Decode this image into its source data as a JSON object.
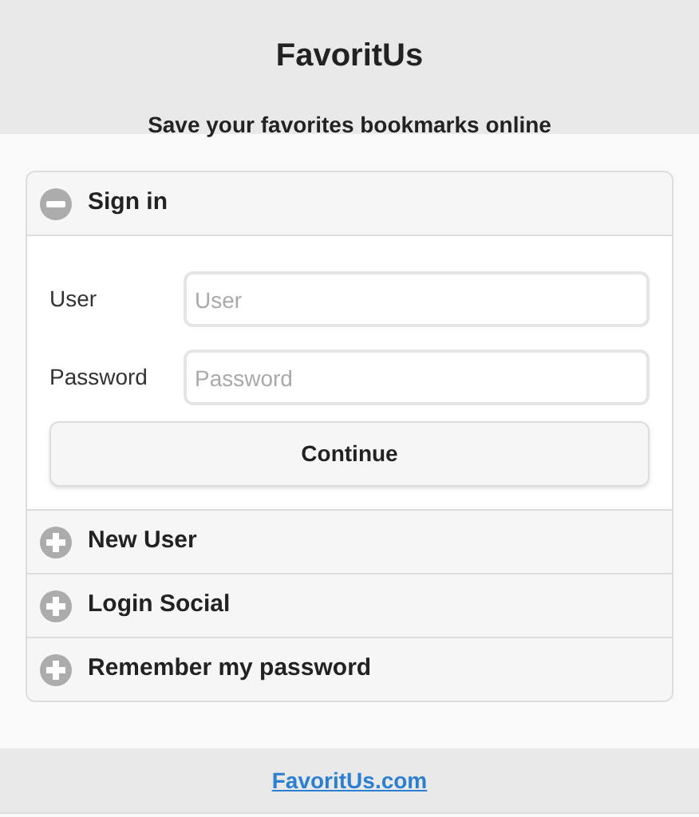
{
  "header": {
    "title": "FavoritUs",
    "subtitle": "Save your favorites bookmarks online"
  },
  "sections": [
    {
      "title": "Sign in",
      "expanded": true,
      "fields": [
        {
          "label": "User",
          "placeholder": "User"
        },
        {
          "label": "Password",
          "placeholder": "Password"
        }
      ],
      "button": "Continue"
    },
    {
      "title": "New User",
      "expanded": false
    },
    {
      "title": "Login Social",
      "expanded": false
    },
    {
      "title": "Remember my password",
      "expanded": false
    }
  ],
  "footer": {
    "link": "FavoritUs.com"
  }
}
